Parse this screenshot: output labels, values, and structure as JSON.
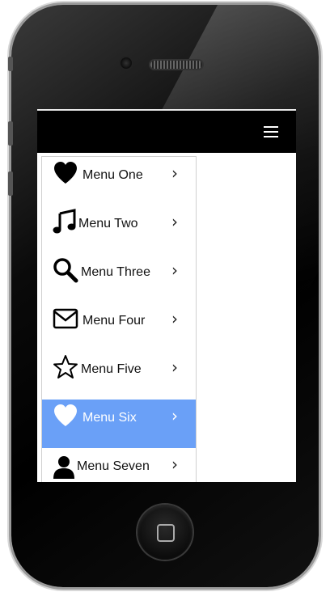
{
  "menu": {
    "items": [
      {
        "label": "Menu One",
        "icon": "heart-icon"
      },
      {
        "label": "Menu Two",
        "icon": "music-note-icon"
      },
      {
        "label": "Menu Three",
        "icon": "search-icon"
      },
      {
        "label": "Menu Four",
        "icon": "envelope-icon"
      },
      {
        "label": "Menu Five",
        "icon": "star-icon"
      },
      {
        "label": "Menu Six",
        "icon": "heart-icon",
        "active": true
      },
      {
        "label": "Menu Seven",
        "icon": "user-icon"
      }
    ],
    "chevron": "›",
    "active_color": "#6aa0f7"
  },
  "topbar": {
    "menu_icon": "hamburger-icon",
    "background": "#000000"
  }
}
